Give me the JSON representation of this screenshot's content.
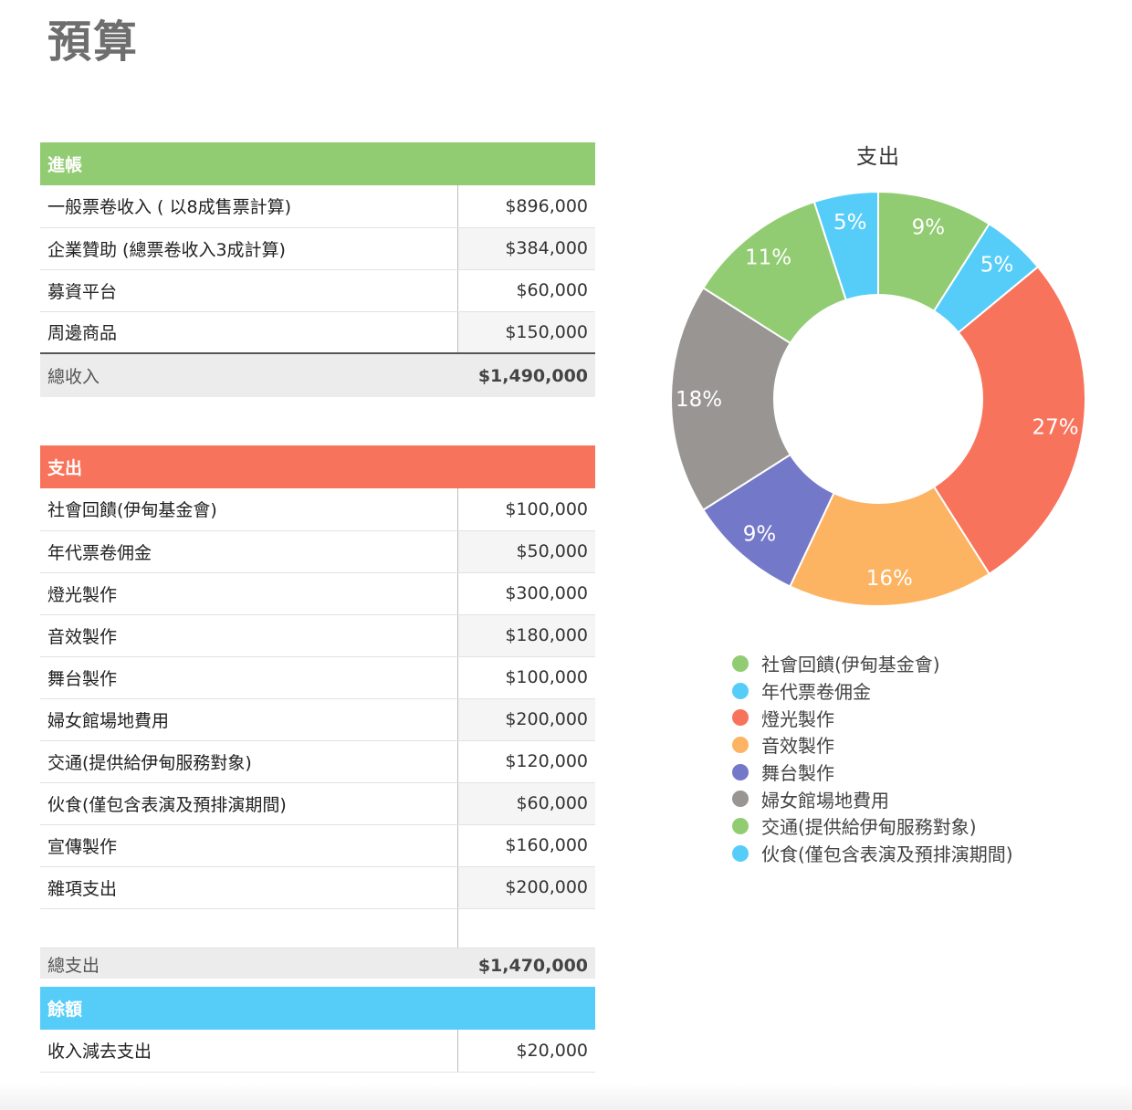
{
  "title": "預算",
  "income": {
    "header": "進帳",
    "color": "#92cc72",
    "rows": [
      {
        "label": "一般票卷收入 ( 以8成售票計算)",
        "value": "$896,000"
      },
      {
        "label": "企業贊助  (總票卷收入3成計算)",
        "value": "$384,000"
      },
      {
        "label": "募資平台",
        "value": "$60,000"
      },
      {
        "label": "周邊商品",
        "value": "$150,000"
      }
    ],
    "total": {
      "label": "總收入",
      "value": "$1,490,000"
    }
  },
  "expense": {
    "header": "支出",
    "color": "#f8735c",
    "rows": [
      {
        "label": "社會回饋(伊甸基金會)",
        "value": "$100,000"
      },
      {
        "label": "年代票卷佣金",
        "value": "$50,000"
      },
      {
        "label": "燈光製作",
        "value": "$300,000"
      },
      {
        "label": "音效製作",
        "value": "$180,000"
      },
      {
        "label": "舞台製作",
        "value": "$100,000"
      },
      {
        "label": "婦女館場地費用",
        "value": "$200,000"
      },
      {
        "label": "交通(提供給伊甸服務對象)",
        "value": "$120,000"
      },
      {
        "label": "伙食(僅包含表演及預排演期間)",
        "value": "$60,000"
      },
      {
        "label": "宣傳製作",
        "value": "$160,000"
      },
      {
        "label": "雜項支出",
        "value": "$200,000"
      }
    ],
    "total": {
      "label": "總支出",
      "value": "$1,470,000"
    }
  },
  "balance": {
    "header": "餘額",
    "color": "#56cdf9",
    "rows": [
      {
        "label": "收入減去支出",
        "value": "$20,000"
      }
    ]
  },
  "chart_data": {
    "type": "pie",
    "title": "支出",
    "slices": [
      {
        "label": "社會回饋(伊甸基金會)",
        "value": 9,
        "color": "#92cc72",
        "pct": "9%"
      },
      {
        "label": "年代票卷佣金",
        "value": 5,
        "color": "#56cdf9",
        "pct": "5%"
      },
      {
        "label": "燈光製作",
        "value": 27,
        "color": "#f8735c",
        "pct": "27%"
      },
      {
        "label": "音效製作",
        "value": 16,
        "color": "#fdb462",
        "pct": "16%"
      },
      {
        "label": "舞台製作",
        "value": 9,
        "color": "#7478c8",
        "pct": "9%"
      },
      {
        "label": "婦女館場地費用",
        "value": 18,
        "color": "#989593",
        "pct": "18%"
      },
      {
        "label": "交通(提供給伊甸服務對象)",
        "value": 11,
        "color": "#92cc72",
        "pct": "11%"
      },
      {
        "label": "伙食(僅包含表演及預排演期間)",
        "value": 5,
        "color": "#56cdf9",
        "pct": "5%"
      }
    ],
    "legend": "bottom",
    "donut": true
  }
}
